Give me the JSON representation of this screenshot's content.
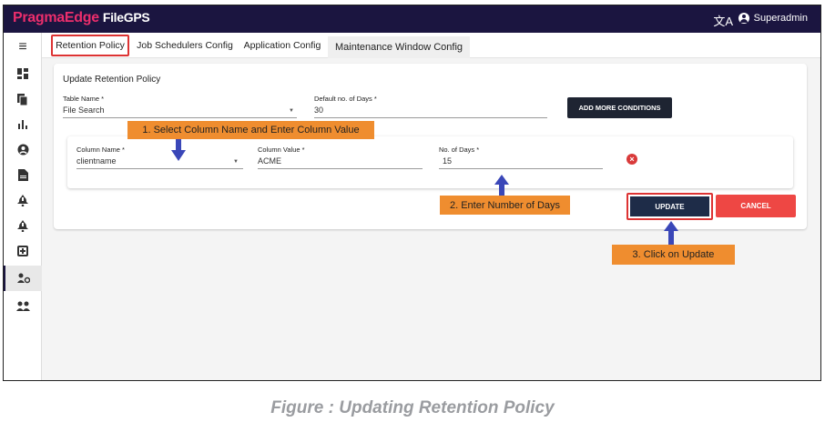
{
  "header": {
    "logo_brand": "PragmaEdge",
    "logo_product": "FileGPS",
    "translate_icon": "文A",
    "user_name": "Superadmin"
  },
  "sidebar": {
    "items": [
      {
        "icon": "menu-icon",
        "glyph": "≡"
      },
      {
        "icon": "dashboard-icon",
        "glyph": "▚"
      },
      {
        "icon": "files-icon",
        "glyph": "❐"
      },
      {
        "icon": "bar-chart-icon",
        "glyph": "ıl"
      },
      {
        "icon": "account-circle-icon",
        "glyph": "◉"
      },
      {
        "icon": "document-icon",
        "glyph": "▤"
      },
      {
        "icon": "alert-bell-icon",
        "glyph": "⍋"
      },
      {
        "icon": "notification-bell-icon",
        "glyph": "⍋"
      },
      {
        "icon": "plus-box-icon",
        "glyph": "⊞"
      },
      {
        "icon": "user-settings-icon",
        "glyph": "⚙"
      },
      {
        "icon": "group-icon",
        "glyph": "⚇"
      }
    ],
    "active_index": 9
  },
  "tabs": {
    "retention": "Retention Policy",
    "scheduler": "Job Schedulers Config",
    "application": "Application Config",
    "maintenance": "Maintenance Window Config"
  },
  "form": {
    "title": "Update Retention Policy",
    "table_name_label": "Table Name *",
    "table_name_value": "File Search",
    "default_days_label": "Default no. of Days *",
    "default_days_value": "30",
    "add_conditions_label": "ADD MORE CONDITIONS",
    "condition": {
      "column_name_label": "Column Name *",
      "column_name_value": "clientname",
      "column_value_label": "Column Value *",
      "column_value_value": "ACME",
      "days_label": "No. of Days *",
      "days_value": "15"
    },
    "update_label": "UPDATE",
    "cancel_label": "CANCEL"
  },
  "annotations": {
    "step1": "1. Select Column Name and Enter Column Value",
    "step2": "2. Enter Number of Days",
    "step3": "3. Click on Update"
  },
  "caption": "Figure : Updating Retention Policy",
  "colors": {
    "topbar": "#1b1540",
    "brand": "#ec2e6c",
    "callout": "#ef8d2f",
    "arrow": "#3a47b8",
    "highlight": "#dd3333",
    "cancel": "#ee4744"
  }
}
